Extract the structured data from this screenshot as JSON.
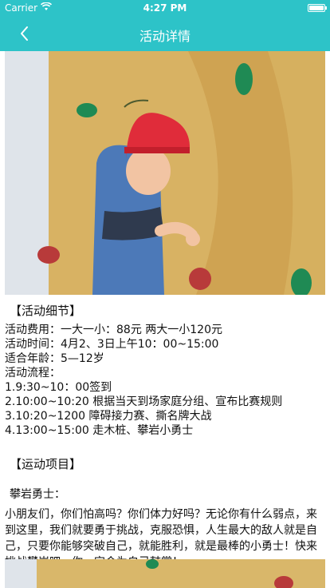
{
  "status": {
    "carrier": "Carrier",
    "time": "4:27 PM"
  },
  "nav": {
    "title": "活动详情"
  },
  "hero": {
    "alt": "攀岩儿童"
  },
  "details": {
    "title": "【活动细节】",
    "lines": [
      "活动费用：一大一小：88元 两大一小120元",
      "活动时间：4月2、3日上午10：00~15:00",
      "适合年龄：5—12岁",
      "活动流程：",
      "1.9:30~10：00签到",
      "2.10:00~10:20 根据当天到场家庭分组、宣布比赛规则",
      "3.10:20~1200  障碍接力赛、撕名牌大战",
      "4.13:00~15:00 走木桩、攀岩小勇士"
    ]
  },
  "projects": {
    "title": "【运动项目】",
    "sub": "攀岩勇士：",
    "para": "小朋友们，你们怕高吗？你们体力好吗？无论你有什么弱点，来到这里，我们就要勇于挑战，克服恐惧，人生最大的敌人就是自己，只要你能够突破自己，就能胜利，就是最棒的小勇士！快来挑战攀岩吧，你一定会为自己鼓掌！"
  }
}
